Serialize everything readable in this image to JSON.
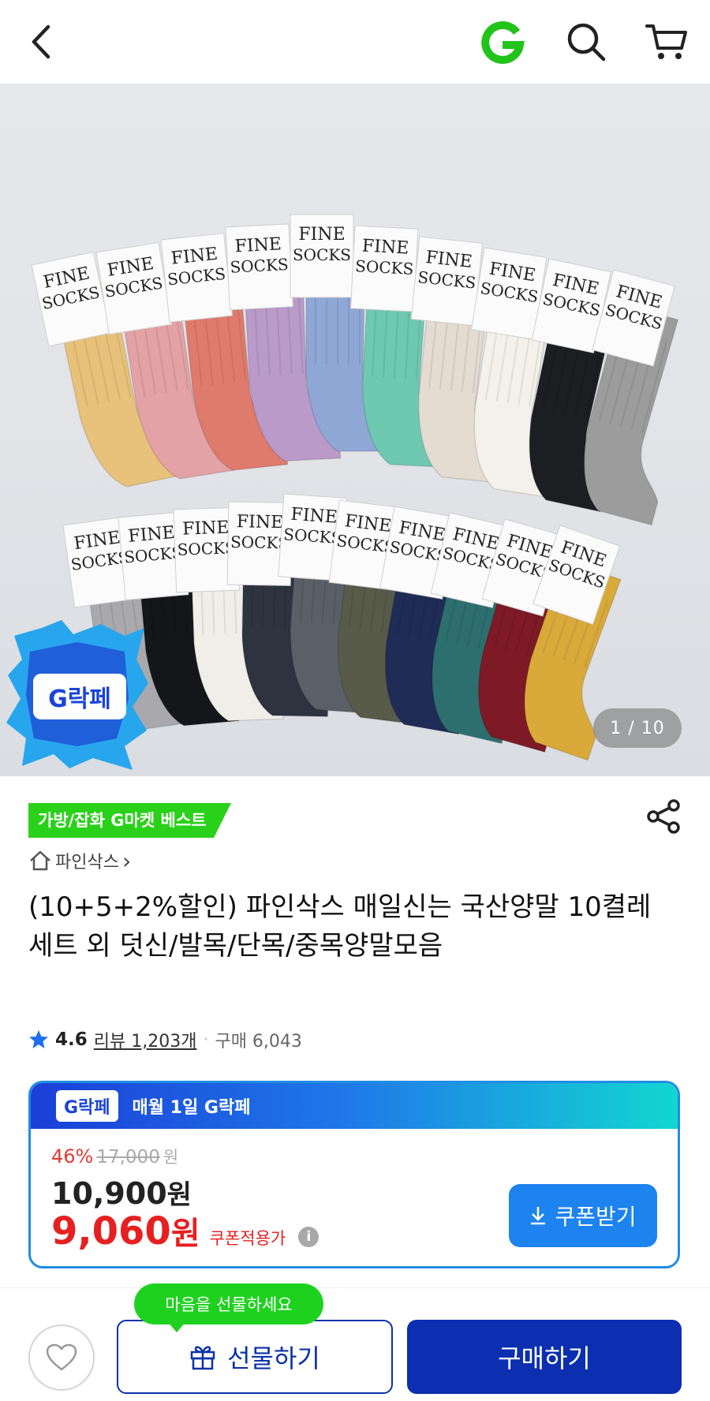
{
  "header": {
    "back_icon": "chevron-left-icon",
    "logo_letter": "G",
    "logo_color": "#22c31a",
    "search_icon": "search-icon",
    "cart_icon": "cart-icon"
  },
  "image": {
    "brand_tag_line1": "FINE",
    "brand_tag_line2": "SOCKS",
    "promo_sticker": "G락페",
    "pager": "1 / 10"
  },
  "product": {
    "best_badge": "가방/잡화 G마켓 베스트",
    "store_name": "파인삭스",
    "store_chevron": "›",
    "title": "(10+5+2%할인) 파인삭스 매일신는 국산양말 10켤레세트 외 덧신/발목/단목/중목양말모음",
    "rating": "4.6",
    "review_text": "리뷰 1,203개",
    "separator": "·",
    "purchase_text": "구매 6,043"
  },
  "price_box": {
    "promo_logo": "G락페",
    "promo_title": "매월 1일 G락페",
    "discount_rate": "46%",
    "original_price": "17,000",
    "original_won": "원",
    "sale_price": "10,900",
    "sale_won": "원",
    "coupon_price": "9,060",
    "coupon_won": "원",
    "coupon_label": "쿠폰적용가",
    "info_icon": "i",
    "coupon_button": "쿠폰받기"
  },
  "bottom_bar": {
    "tooltip": "마음을 선물하세요",
    "gift_button": "선물하기",
    "buy_button": "구매하기"
  },
  "colors": {
    "accent_green": "#2ad11a",
    "accent_blue": "#1d83ef",
    "buy_navy": "#0b2fb0",
    "price_red": "#e62020"
  }
}
